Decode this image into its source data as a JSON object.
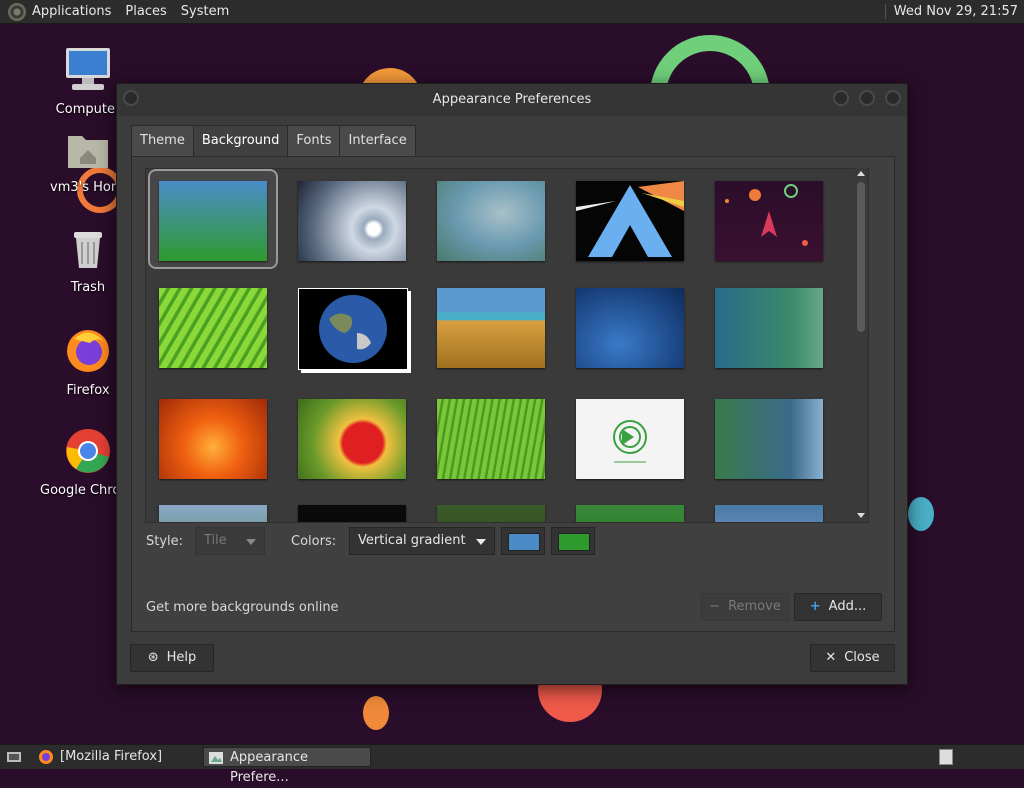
{
  "top_panel": {
    "menus": [
      "Applications",
      "Places",
      "System"
    ],
    "clock": "Wed Nov 29, 21:57"
  },
  "desktop": {
    "icons": [
      {
        "label": "Computer",
        "icon": "computer-icon"
      },
      {
        "label": "vm3's Home",
        "icon": "home-folder-icon"
      },
      {
        "label": "Trash",
        "icon": "trash-icon"
      },
      {
        "label": "Firefox",
        "icon": "firefox-icon"
      },
      {
        "label": "Google Chrome",
        "icon": "chrome-icon"
      }
    ]
  },
  "window": {
    "title": "Appearance Preferences",
    "tabs": [
      "Theme",
      "Background",
      "Fonts",
      "Interface"
    ],
    "active_tab": "Background",
    "wallpapers": [
      "blue-green-gradient",
      "water-drop",
      "soft-green-blur",
      "arch-pyramid-rainbow",
      "space-rocket",
      "green-leaf",
      "earth-globe",
      "wheat-field",
      "blue-abstract-bubbles",
      "teal-dots",
      "orange-flower",
      "red-flower",
      "green-grass",
      "green-swirl-logo",
      "blue-wave",
      "partial-1",
      "partial-2",
      "partial-3",
      "partial-4",
      "partial-5"
    ],
    "style_label": "Style:",
    "style_value": "Tile",
    "colors_label": "Colors:",
    "colors_value": "Vertical gradient",
    "color1": "#4a8cc8",
    "color2": "#2e9a2e",
    "get_more_label": "Get more backgrounds online",
    "remove_label": "Remove",
    "add_label": "Add...",
    "help_label": "Help",
    "close_label": "Close"
  },
  "taskbar": {
    "tasks": [
      "[Mozilla Firefox]",
      "Appearance Prefere..."
    ]
  }
}
